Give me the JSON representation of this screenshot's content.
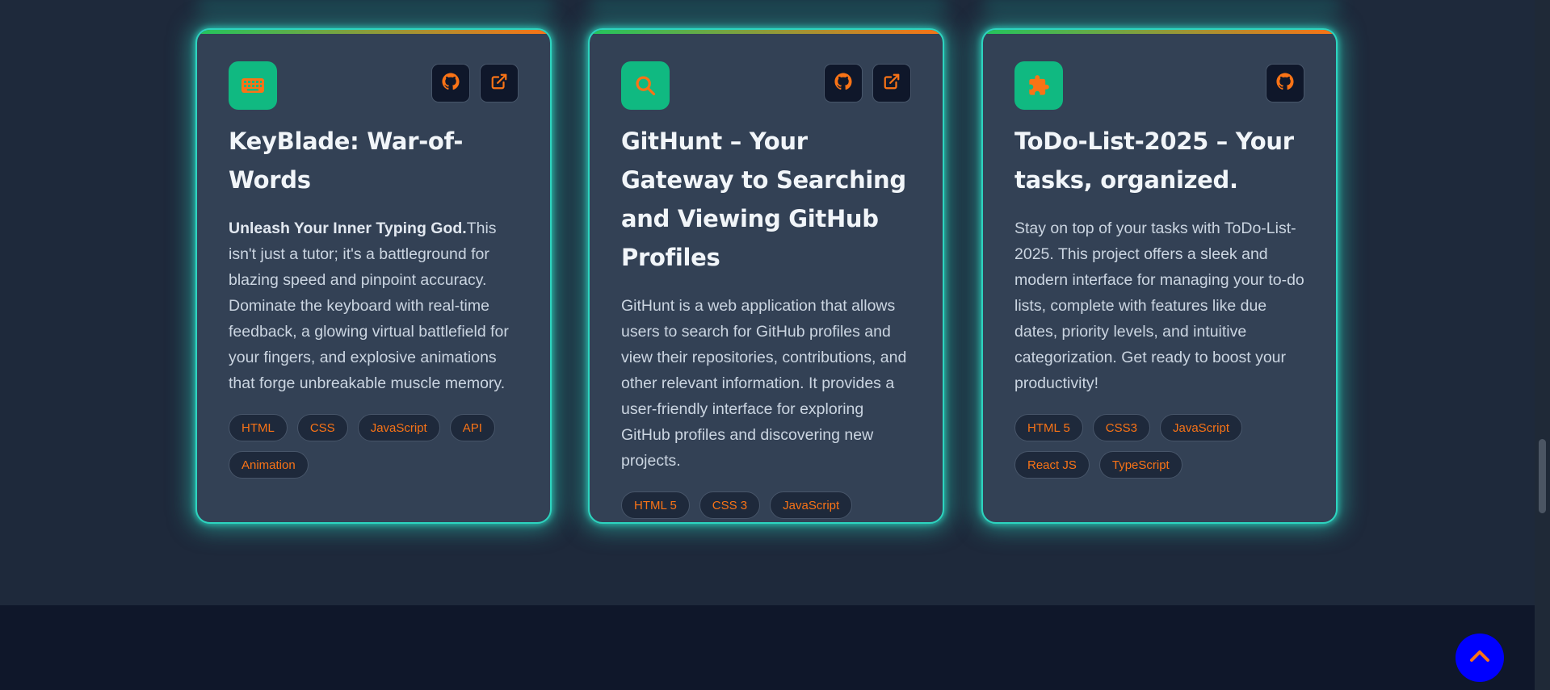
{
  "projects": [
    {
      "icon": "keyboard-icon",
      "title": "KeyBlade: War-of-Words",
      "desc_bold": "Unleash Your Inner Typing God.",
      "description": "This isn't just a tutor; it's a battleground for blazing speed and pinpoint accuracy. Dominate the keyboard with real-time feedback, a glowing virtual battlefield for your fingers, and explosive animations that forge unbreakable muscle memory.",
      "tags": [
        "HTML",
        "CSS",
        "JavaScript",
        "API",
        "Animation"
      ],
      "links": [
        "github-icon",
        "external-link-icon"
      ]
    },
    {
      "icon": "search-icon",
      "title": "GitHunt – Your Gateway to Searching and Viewing GitHub Profiles",
      "desc_bold": "",
      "description": "GitHunt is a web application that allows users to search for GitHub profiles and view their repositories, contributions, and other relevant information. It provides a user-friendly interface for exploring GitHub profiles and discovering new projects.",
      "tags": [
        "HTML 5",
        "CSS 3",
        "JavaScript"
      ],
      "links": [
        "github-icon",
        "external-link-icon"
      ]
    },
    {
      "icon": "puzzle-icon",
      "title": "ToDo-List-2025 – Your tasks, organized.",
      "desc_bold": "",
      "description": "Stay on top of your tasks with ToDo-List-2025. This project offers a sleek and modern interface for managing your to-do lists, complete with features like due dates, priority levels, and intuitive categorization. Get ready to boost your productivity!",
      "tags": [
        "HTML 5",
        "CSS3",
        "JavaScript",
        "React JS",
        "TypeScript"
      ],
      "links": [
        "github-icon"
      ]
    }
  ],
  "colors": {
    "accent": "#f97316",
    "glow": "#2dd4bf",
    "icon_tile": "#10b981",
    "back_to_top": "#0000ff"
  },
  "back_to_top_icon": "chevron-up-icon"
}
